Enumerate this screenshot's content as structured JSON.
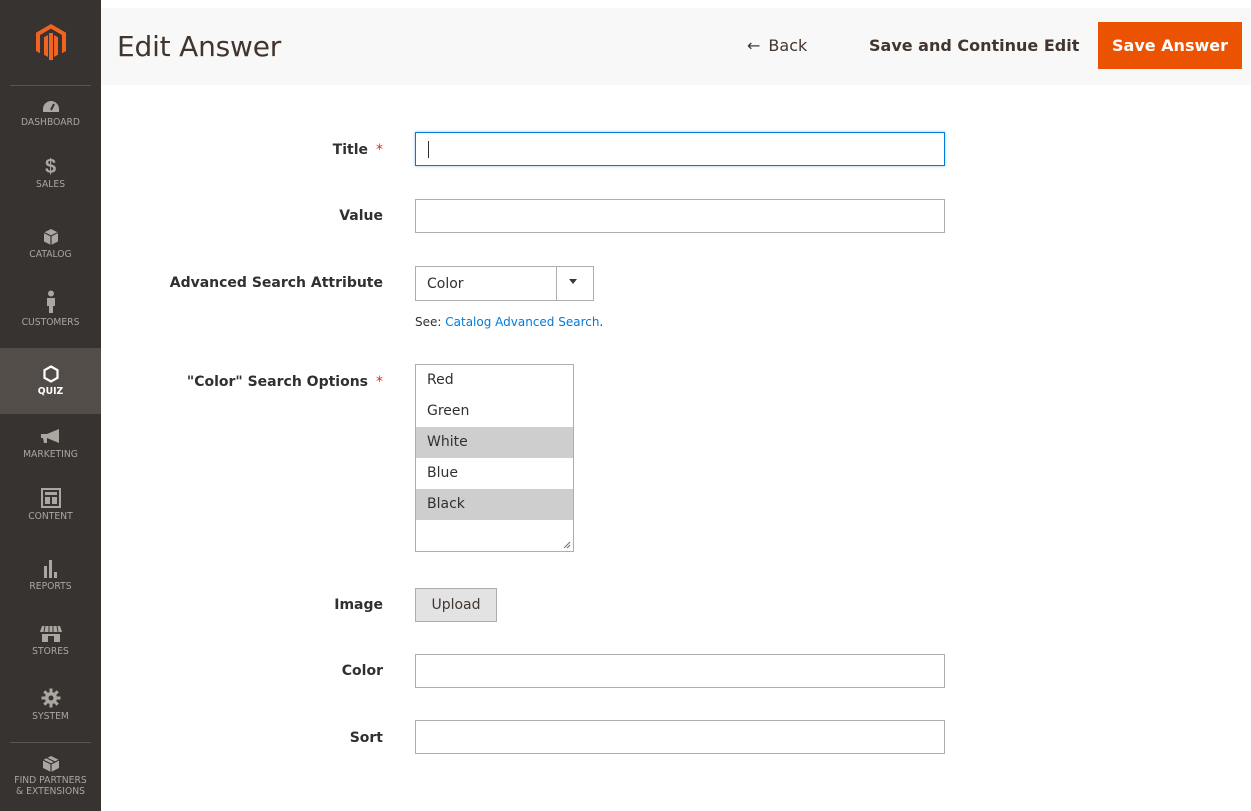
{
  "sidebar": {
    "logo": "magento-logo",
    "items": [
      {
        "label": "DASHBOARD",
        "icon": "dashboard-icon"
      },
      {
        "label": "SALES",
        "icon": "dollar-icon"
      },
      {
        "label": "CATALOG",
        "icon": "box-icon"
      },
      {
        "label": "CUSTOMERS",
        "icon": "person-icon"
      },
      {
        "label": "QUIZ",
        "icon": "hexagon-icon",
        "active": true
      },
      {
        "label": "MARKETING",
        "icon": "megaphone-icon"
      },
      {
        "label": "CONTENT",
        "icon": "layout-icon"
      },
      {
        "label": "REPORTS",
        "icon": "bar-chart-icon"
      },
      {
        "label": "STORES",
        "icon": "storefront-icon"
      },
      {
        "label": "SYSTEM",
        "icon": "gear-icon"
      },
      {
        "label": "FIND PARTNERS & EXTENSIONS",
        "label_line1": "FIND PARTNERS",
        "label_line2": "& EXTENSIONS",
        "icon": "cubes-icon"
      }
    ]
  },
  "header": {
    "title": "Edit Answer",
    "back_label": "Back",
    "continue_label": "Save and Continue Edit",
    "save_label": "Save Answer"
  },
  "form": {
    "title_label": "Title",
    "title_value": "",
    "value_label": "Value",
    "value_value": "",
    "adv_label": "Advanced Search Attribute",
    "adv_selected": "Color",
    "note_prefix": "See: ",
    "note_link": "Catalog Advanced Search",
    "note_suffix": ".",
    "options_label": "\"Color\" Search Options",
    "options": [
      {
        "label": "Red",
        "selected": false
      },
      {
        "label": "Green",
        "selected": false
      },
      {
        "label": "White",
        "selected": true
      },
      {
        "label": "Blue",
        "selected": false
      },
      {
        "label": "Black",
        "selected": true
      }
    ],
    "image_label": "Image",
    "upload_label": "Upload",
    "color_label": "Color",
    "color_value": "",
    "sort_label": "Sort",
    "sort_value": ""
  },
  "colors": {
    "sidebar_bg": "#373330",
    "accent": "#eb5202",
    "link": "#007bdb",
    "required": "#e22626"
  }
}
